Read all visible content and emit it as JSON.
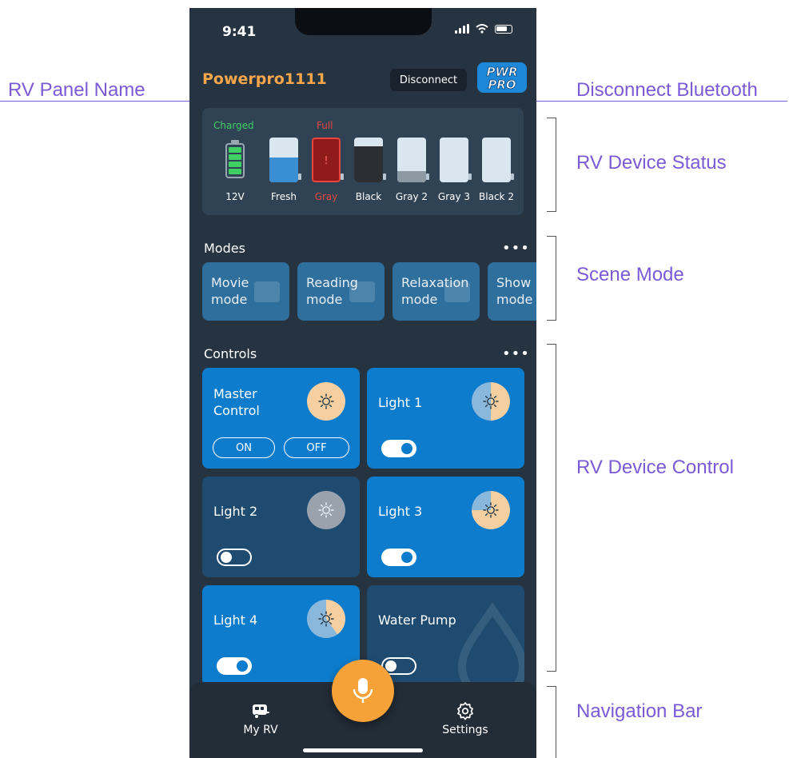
{
  "annotations": {
    "rv_panel_name": "RV Panel Name",
    "disconnect_bluetooth": "Disconnect Bluetooth",
    "rv_device_status": "RV Device Status",
    "scene_mode": "Scene Mode",
    "rv_device_control": "RV Device Control",
    "navigation_bar": "Navigation Bar"
  },
  "status_bar": {
    "time": "9:41"
  },
  "header": {
    "panel_name": "Powerpro1111",
    "disconnect_label": "Disconnect",
    "logo_top": "PWR",
    "logo_bottom": "PRO"
  },
  "device_status": {
    "battery_status": "Charged",
    "battery_label": "12V",
    "alert_status": "Full",
    "tanks": [
      {
        "label": "Fresh",
        "level": 0.55,
        "color": "#3a8fd2",
        "alert": false
      },
      {
        "label": "Gray",
        "level": 1.0,
        "color": "#8f1b1b",
        "alert": true
      },
      {
        "label": "Black",
        "level": 0.8,
        "color": "#2b2f33",
        "alert": false
      },
      {
        "label": "Gray 2",
        "level": 0.25,
        "color": "#8e9aa3",
        "alert": false
      },
      {
        "label": "Gray 3",
        "level": 0.0,
        "color": "#8e9aa3",
        "alert": false
      },
      {
        "label": "Black 2",
        "level": 0.0,
        "color": "#2b2f33",
        "alert": false
      }
    ]
  },
  "modes": {
    "title": "Modes",
    "more": "•••",
    "items": [
      {
        "line1": "Movie",
        "line2": "mode"
      },
      {
        "line1": "Reading",
        "line2": "mode"
      },
      {
        "line1": "Relaxation",
        "line2": "mode"
      },
      {
        "line1": "Show",
        "line2": "mode"
      }
    ]
  },
  "controls": {
    "title": "Controls",
    "more": "•••",
    "master": {
      "line1": "Master",
      "line2": "Control",
      "on_label": "ON",
      "off_label": "OFF"
    },
    "light1": {
      "label": "Light 1",
      "on": true,
      "level": 0.5
    },
    "light2": {
      "label": "Light 2",
      "on": false,
      "level": 0.0
    },
    "light3": {
      "label": "Light 3",
      "on": true,
      "level": 0.75
    },
    "light4": {
      "label": "Light 4",
      "on": true,
      "level": 0.4
    },
    "water_pump": {
      "label": "Water Pump",
      "on": false
    }
  },
  "nav": {
    "my_rv": "My RV",
    "settings": "Settings"
  },
  "colors": {
    "accent_orange": "#f6a64a",
    "tile_on": "#0d7ccc",
    "tile_off": "#1f4b70",
    "annotation": "#7b5ad6",
    "ok_green": "#3fcf62",
    "alert_red": "#e8453b"
  }
}
